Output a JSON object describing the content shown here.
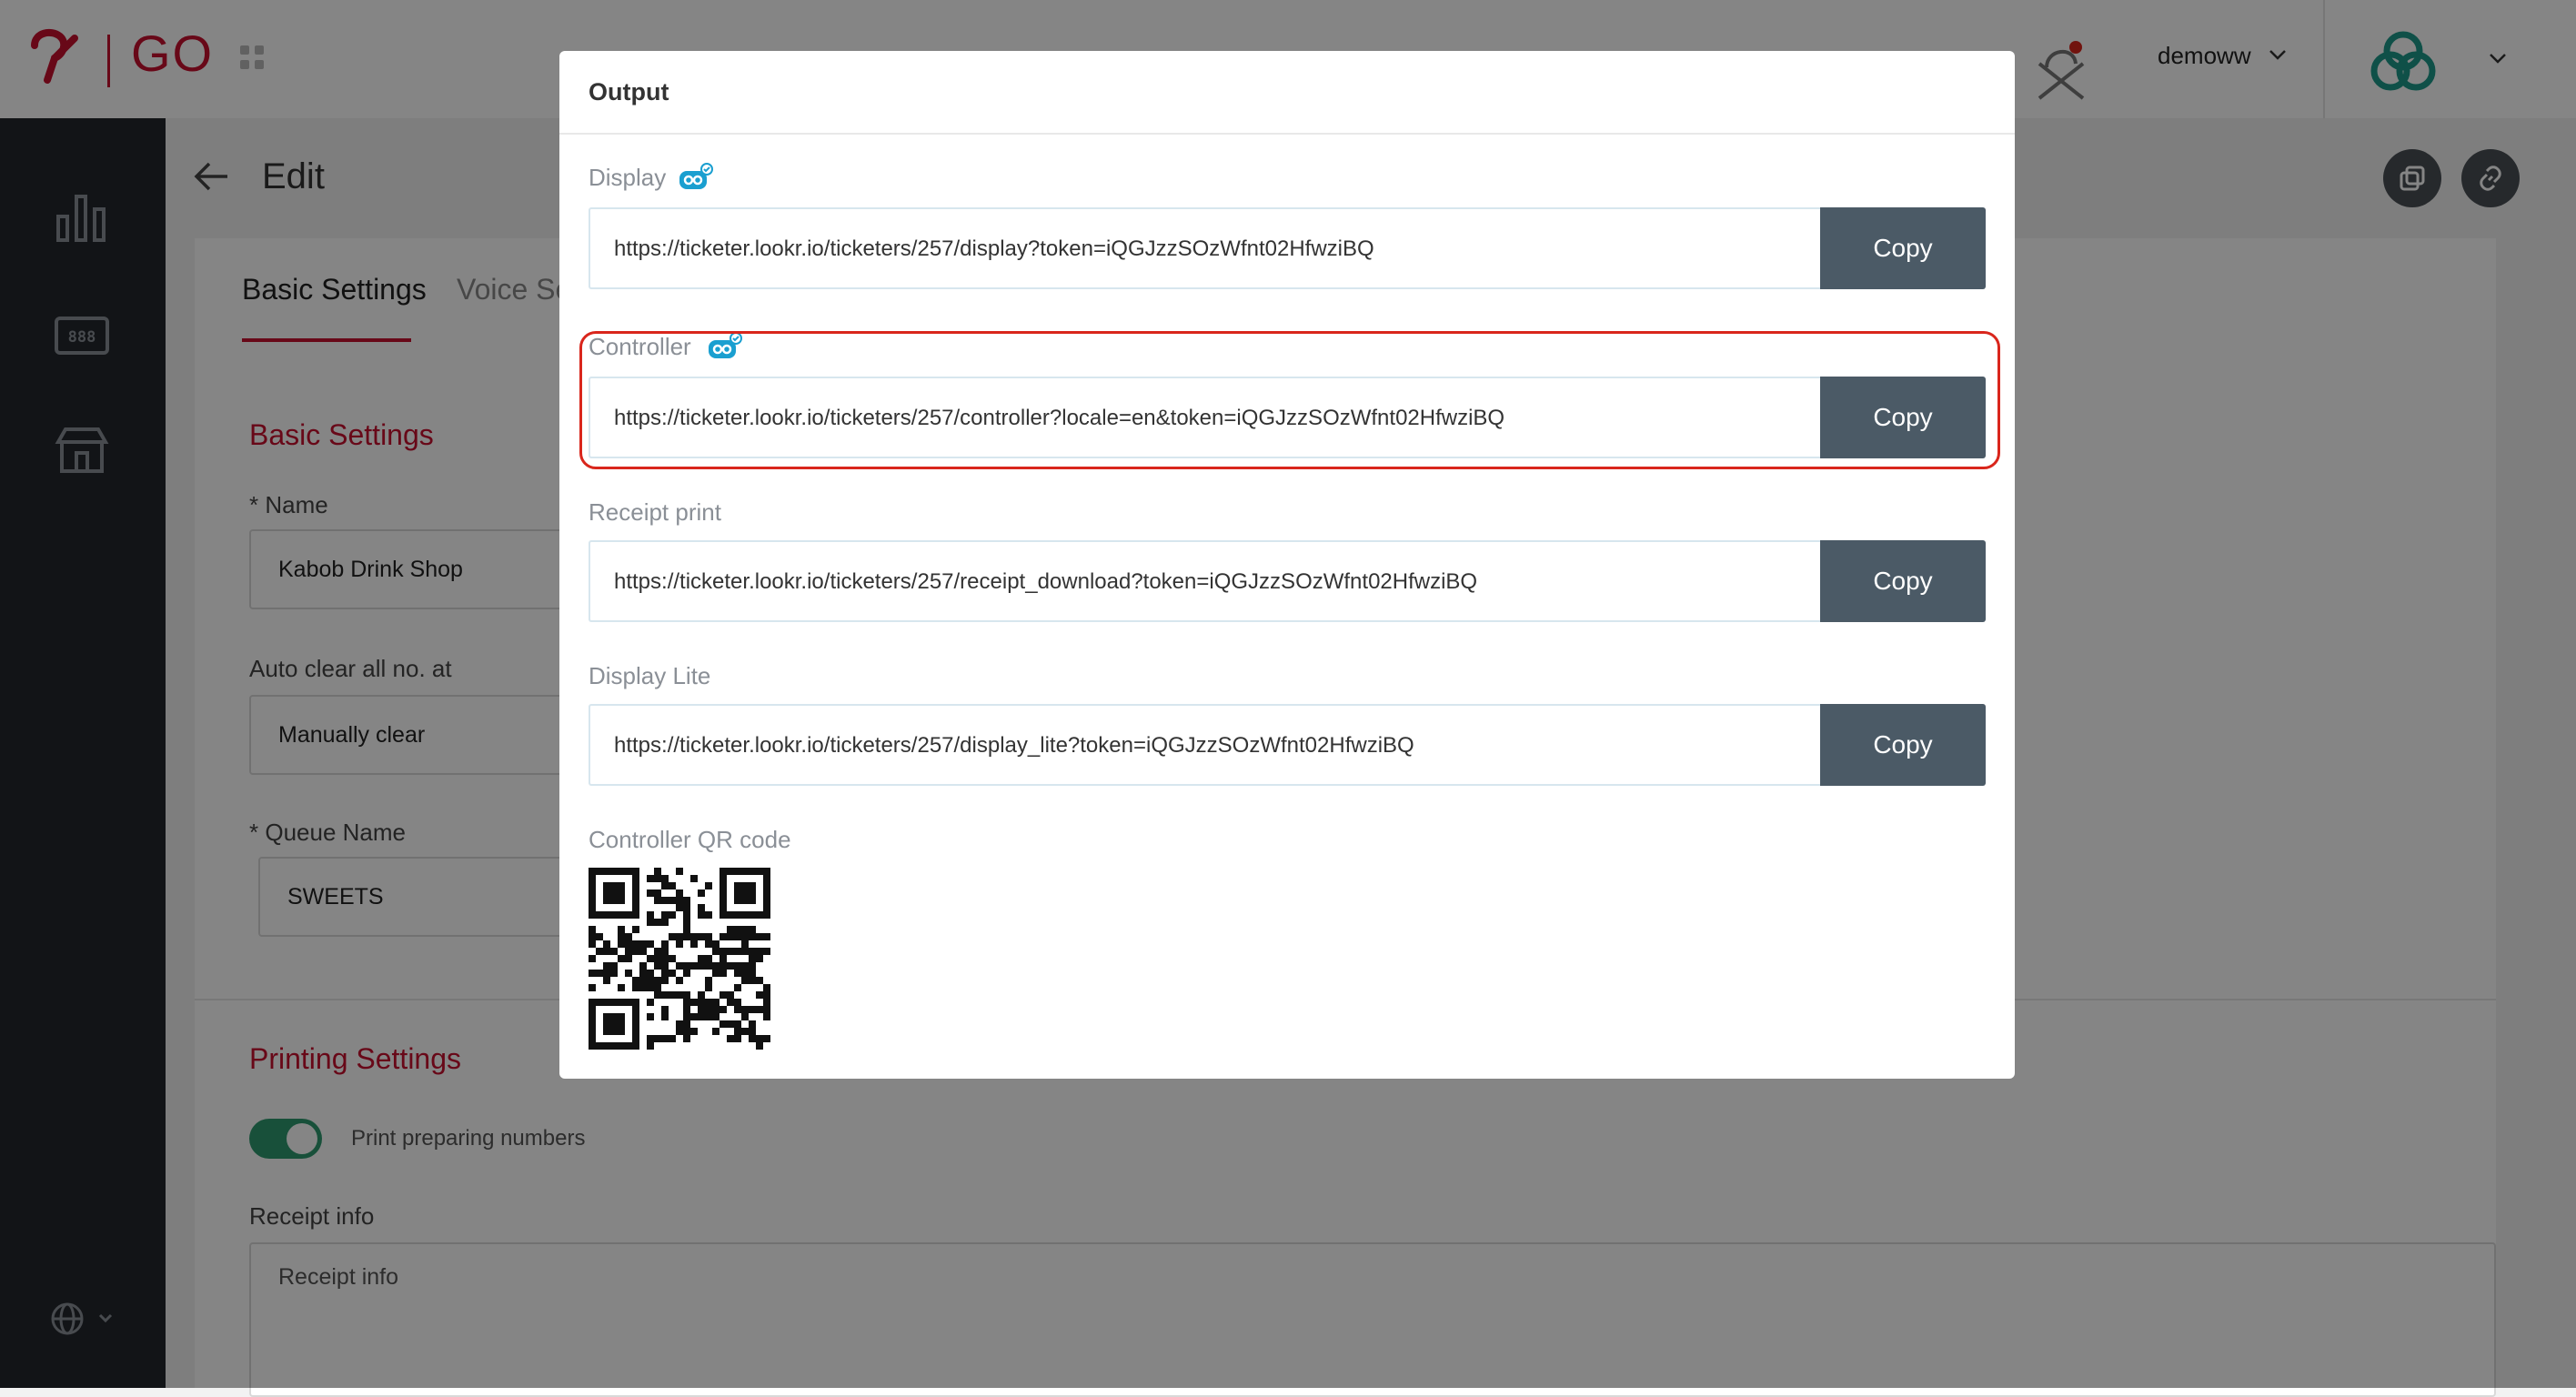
{
  "header": {
    "brand": "GO",
    "user": "demoww"
  },
  "page": {
    "title": "Edit",
    "tabs": [
      {
        "label": "Basic Settings",
        "active": true
      },
      {
        "label": "Voice Se",
        "active": false
      }
    ]
  },
  "form": {
    "basic_section_title": "Basic Settings",
    "name_label": "* Name",
    "name_value": "Kabob Drink Shop",
    "auto_clear_label": "Auto clear all no. at",
    "auto_clear_value": "Manually clear",
    "queue_name_label": "* Queue Name",
    "queue_name_value": "SWEETS",
    "printing_section_title": "Printing Settings",
    "print_preparing_label": "Print preparing numbers",
    "print_preparing_enabled": true,
    "receipt_info_label": "Receipt info",
    "receipt_info_placeholder": "Receipt info"
  },
  "modal": {
    "title": "Output",
    "outputs": [
      {
        "label": "Display",
        "url": "https://ticketer.lookr.io/ticketers/257/display?token=iQGJzzSOzWfnt02HfwziBQ",
        "copy": "Copy"
      },
      {
        "label": "Controller",
        "url": "https://ticketer.lookr.io/ticketers/257/controller?locale=en&token=iQGJzzSOzWfnt02HfwziBQ",
        "copy": "Copy"
      },
      {
        "label": "Receipt print",
        "url": "https://ticketer.lookr.io/ticketers/257/receipt_download?token=iQGJzzSOzWfnt02HfwziBQ",
        "copy": "Copy"
      },
      {
        "label": "Display Lite",
        "url": "https://ticketer.lookr.io/ticketers/257/display_lite?token=iQGJzzSOzWfnt02HfwziBQ",
        "copy": "Copy"
      }
    ],
    "qr_label": "Controller QR code"
  },
  "colors": {
    "brand": "#c8102e",
    "copy_button": "#4b5a66",
    "toggle_on": "#2e9a6f",
    "highlight": "#d9261c"
  }
}
